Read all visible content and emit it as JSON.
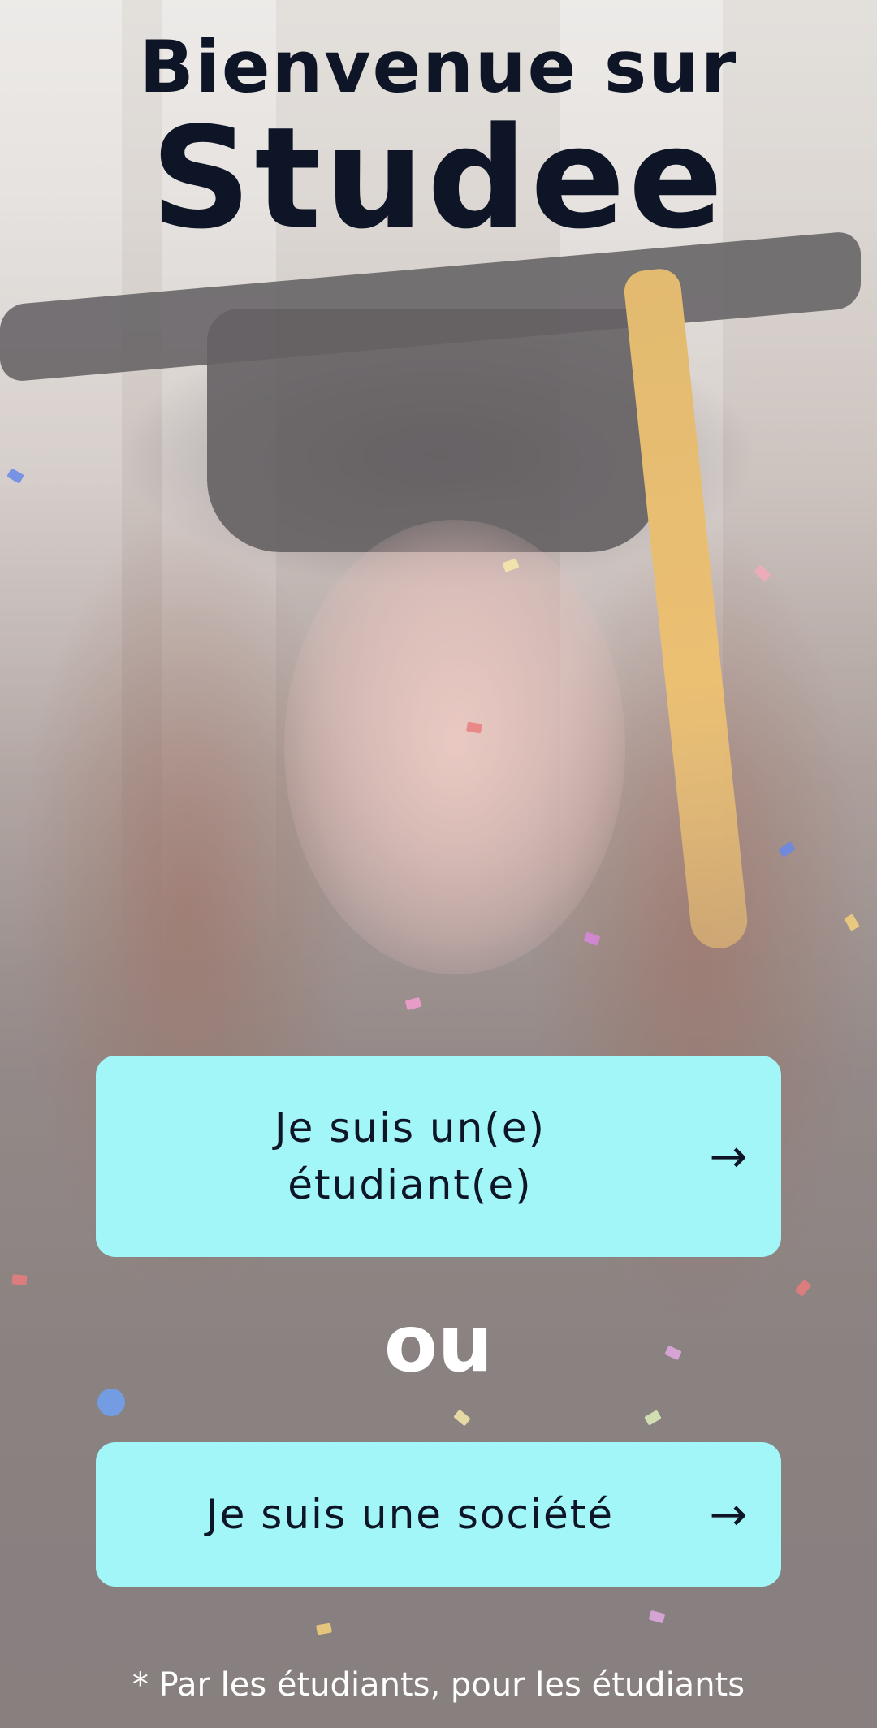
{
  "header": {
    "title_line1": "Bienvenue sur",
    "title_line2": "Studee"
  },
  "choices": {
    "student_label": "Je suis un(e)\nétudiant(e)",
    "separator": "ou",
    "company_label": "Je suis une société"
  },
  "footer": {
    "tagline": "* Par les étudiants, pour les étudiants"
  },
  "icons": {
    "arrow": "arrow-right-icon",
    "arrow_glyph": "→"
  },
  "colors": {
    "title": "#0d1526",
    "button_bg": "#a3f6f7",
    "button_text": "#0d1526",
    "separator_text": "#ffffff",
    "tagline_text": "#ffffff"
  }
}
